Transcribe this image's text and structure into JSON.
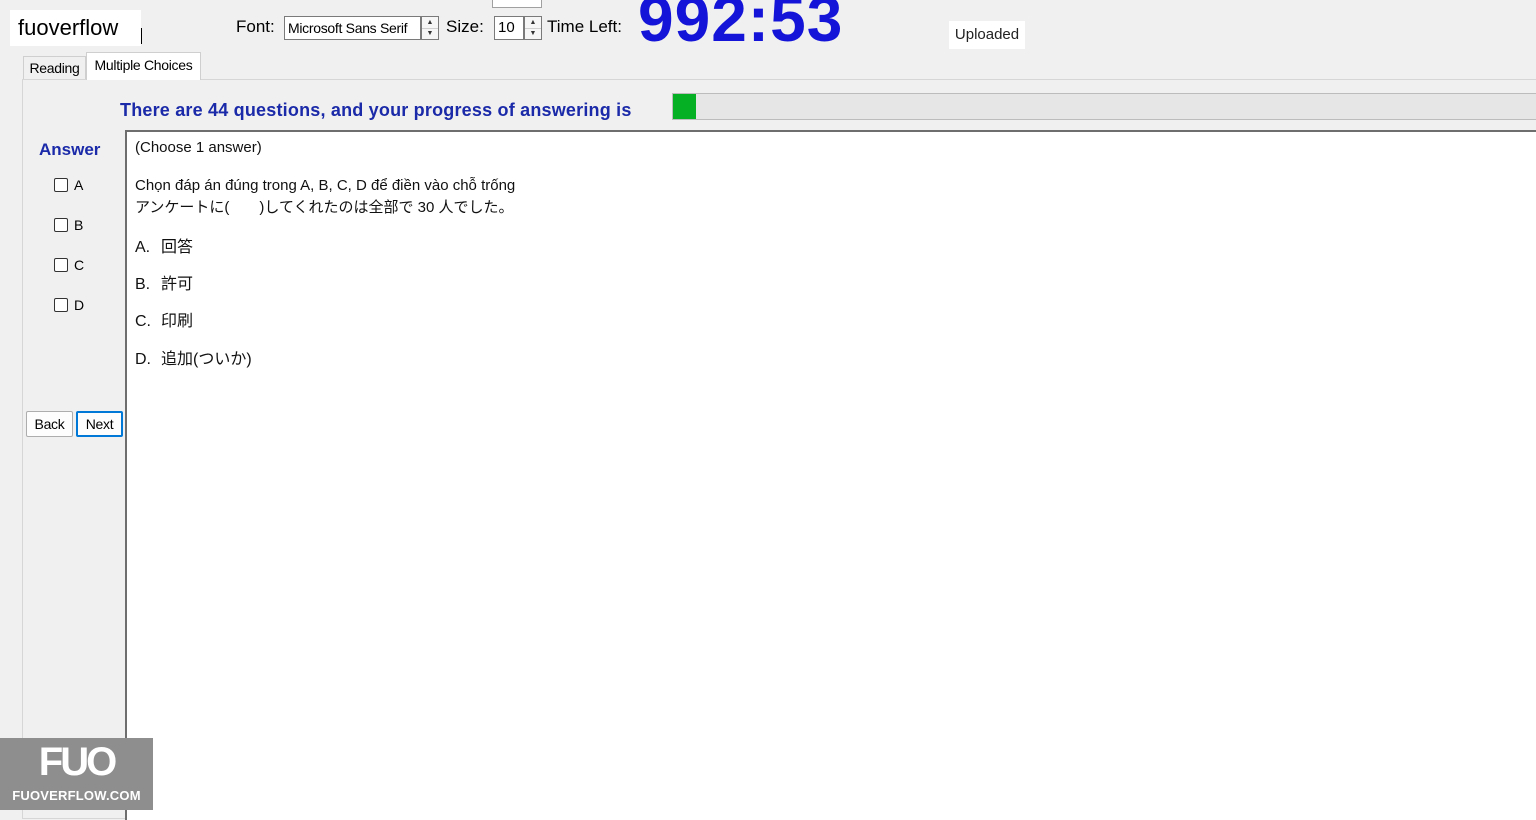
{
  "header": {
    "user_label": "fuoverflow",
    "font_label": "Font:",
    "font_value": "Microsoft Sans Serif",
    "size_label": "Size:",
    "size_value": "10",
    "time_left_label": "Time Left:",
    "timer": "992:53",
    "upload_status": "Uploaded"
  },
  "tabs": [
    {
      "label": "Reading",
      "active": false
    },
    {
      "label": "Multiple Choices",
      "active": true
    }
  ],
  "progress": {
    "text": "There are 44 questions, and your progress of answering is",
    "fraction": 0.027
  },
  "answer": {
    "title": "Answer",
    "options": [
      "A",
      "B",
      "C",
      "D"
    ]
  },
  "nav": {
    "back": "Back",
    "next": "Next"
  },
  "question": {
    "instruction": "(Choose 1 answer)",
    "prompt": "Chọn đáp án đúng trong A, B, C, D để điền vào chỗ trống",
    "sentence": "アンケートに(　　)してくれたのは全部で 30 人でした。",
    "choices": [
      {
        "letter": "A.",
        "text": "回答"
      },
      {
        "letter": "B.",
        "text": "許可"
      },
      {
        "letter": "C.",
        "text": "印刷"
      },
      {
        "letter": "D.",
        "text": "追加(ついか)"
      }
    ]
  },
  "watermark": {
    "logo": "FUO",
    "site": "FUOVERFLOW.COM"
  },
  "colors": {
    "timer": "#1414d8",
    "heading_blue": "#1a2aa8",
    "progress_green": "#06b025",
    "focus_border": "#0078d7"
  }
}
